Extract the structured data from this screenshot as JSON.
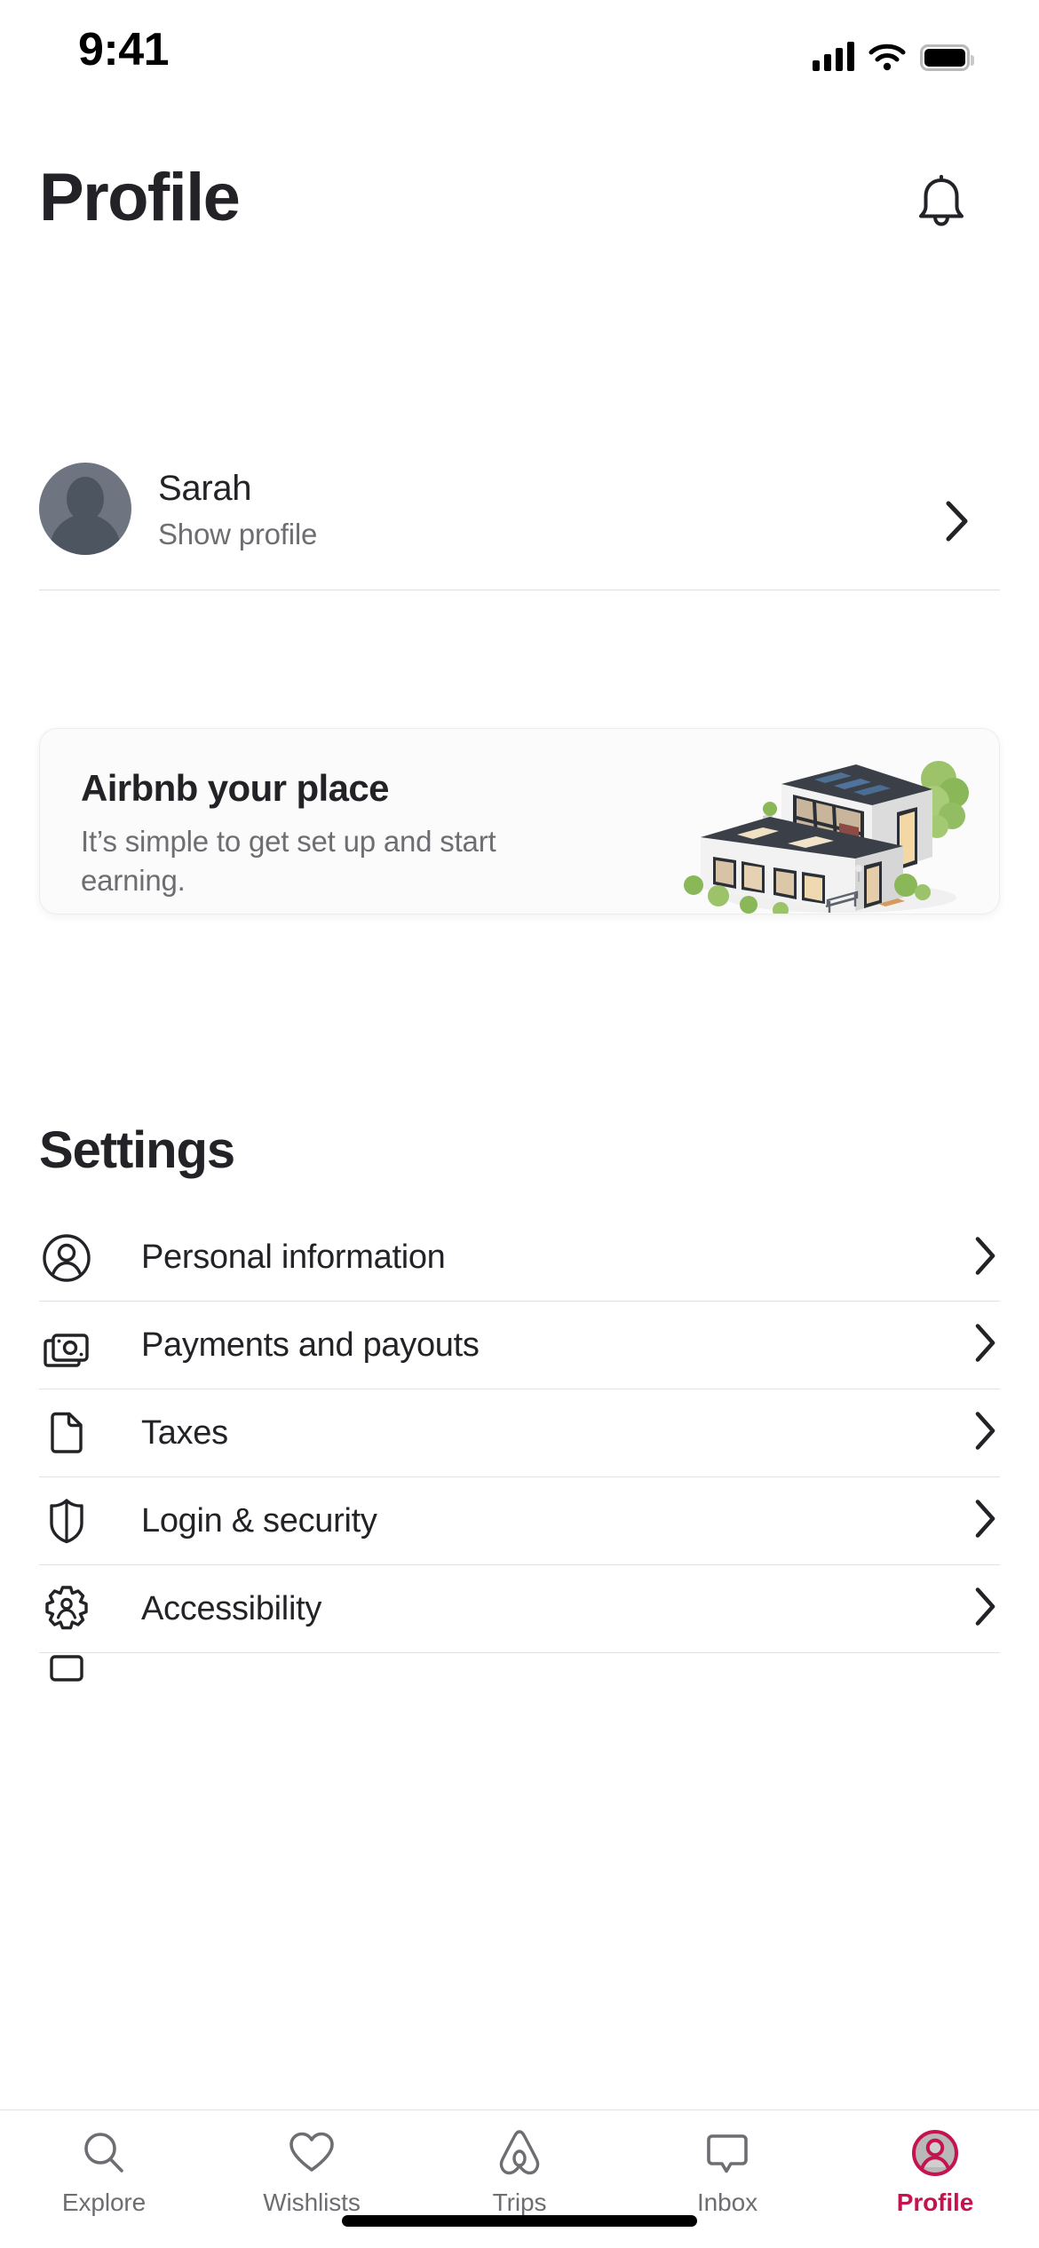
{
  "status_bar": {
    "time": "9:41",
    "signal_icon": "cellular-signal-icon",
    "wifi_icon": "wifi-icon",
    "battery_icon": "battery-icon"
  },
  "header": {
    "title": "Profile",
    "notifications_icon": "bell-icon"
  },
  "user": {
    "name": "Sarah",
    "subtitle": "Show profile",
    "avatar_icon": "avatar",
    "chevron_icon": "chevron-right-icon"
  },
  "promo": {
    "title": "Airbnb your place",
    "subtitle": "It’s simple to get set up and start earning.",
    "illustration_icon": "isometric-house-illustration"
  },
  "settings": {
    "heading": "Settings",
    "items": [
      {
        "label": "Personal information",
        "icon": "person-circle-icon"
      },
      {
        "label": "Payments and payouts",
        "icon": "banknotes-icon"
      },
      {
        "label": "Taxes",
        "icon": "document-icon"
      },
      {
        "label": "Login & security",
        "icon": "shield-icon"
      },
      {
        "label": "Accessibility",
        "icon": "gear-person-icon"
      }
    ],
    "chevron_icon": "chevron-right-icon"
  },
  "tabbar": {
    "items": [
      {
        "label": "Explore",
        "icon": "search-icon",
        "active": false
      },
      {
        "label": "Wishlists",
        "icon": "heart-icon",
        "active": false
      },
      {
        "label": "Trips",
        "icon": "airbnb-belo-icon",
        "active": false
      },
      {
        "label": "Inbox",
        "icon": "message-bubble-icon",
        "active": false
      },
      {
        "label": "Profile",
        "icon": "profile-avatar-icon",
        "active": true
      }
    ]
  },
  "colors": {
    "accent": "#c4134f",
    "text_primary": "#232327",
    "text_secondary": "#6d6d72",
    "divider": "#e2e2e2",
    "card_bg": "#fbfbfb"
  }
}
